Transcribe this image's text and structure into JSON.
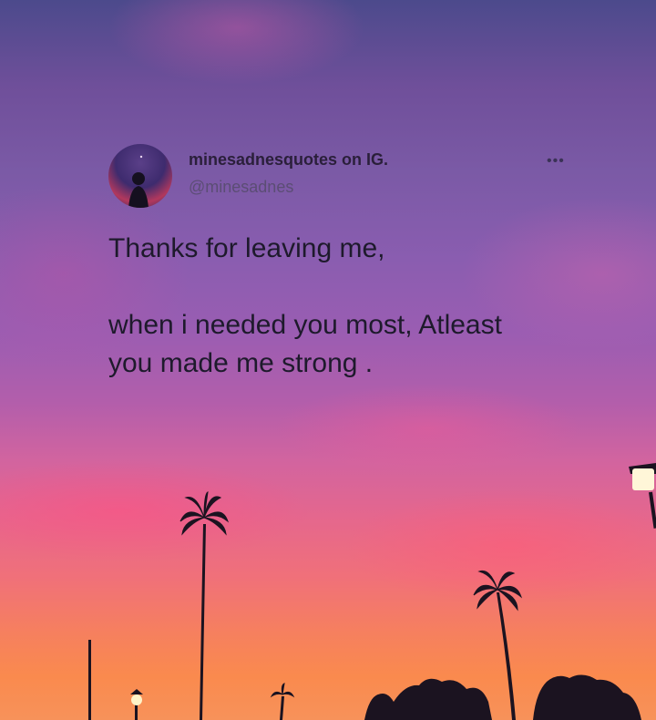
{
  "post": {
    "display_name": "minesadnesquotes on IG.",
    "handle": "@minesadnes",
    "more_icon": "more-dots-icon",
    "avatar_icon": "profile-avatar",
    "lines": [
      "Thanks for leaving me,",
      "when i needed you most, Atleast",
      "you made me strong ."
    ]
  },
  "background": {
    "description_colors": {
      "sky_top": "#4c4a8c",
      "sky_mid": "#9a5db2",
      "sky_pink": "#e5678d",
      "sky_horizon": "#fa8a4e",
      "silhouette": "#1b1320"
    }
  }
}
